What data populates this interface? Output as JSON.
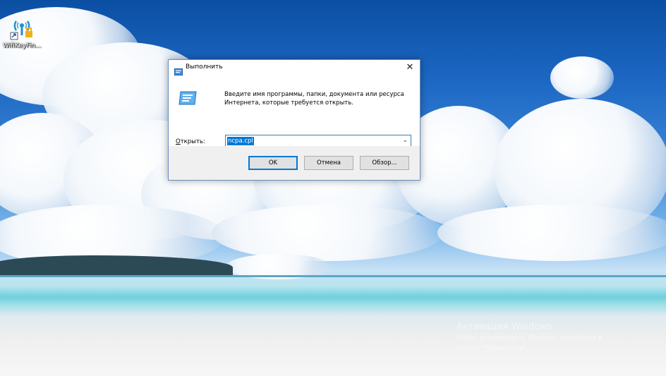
{
  "desktop": {
    "icons": [
      {
        "label": "WifiKeyFin...",
        "icon": "wifi-key-finder-icon"
      }
    ],
    "watermark": {
      "title": "Активация Windows",
      "line1": "Чтобы активировать Windows, перейдите в",
      "line2": "раздел \"Параметры\"."
    }
  },
  "dialog": {
    "title": "Выполнить",
    "close_symbol": "✕",
    "description": "Введите имя программы, папки, документа или ресурса Интернета, которые требуется открыть.",
    "open_label_prefix": "О",
    "open_label_rest": "ткрыть:",
    "command_value": "ncpa.cpl",
    "buttons": {
      "ok": "OK",
      "cancel": "Отмена",
      "browse": "Обзор..."
    }
  },
  "colors": {
    "accent": "#0078d7",
    "dialog_footer": "#f0f0f0"
  }
}
